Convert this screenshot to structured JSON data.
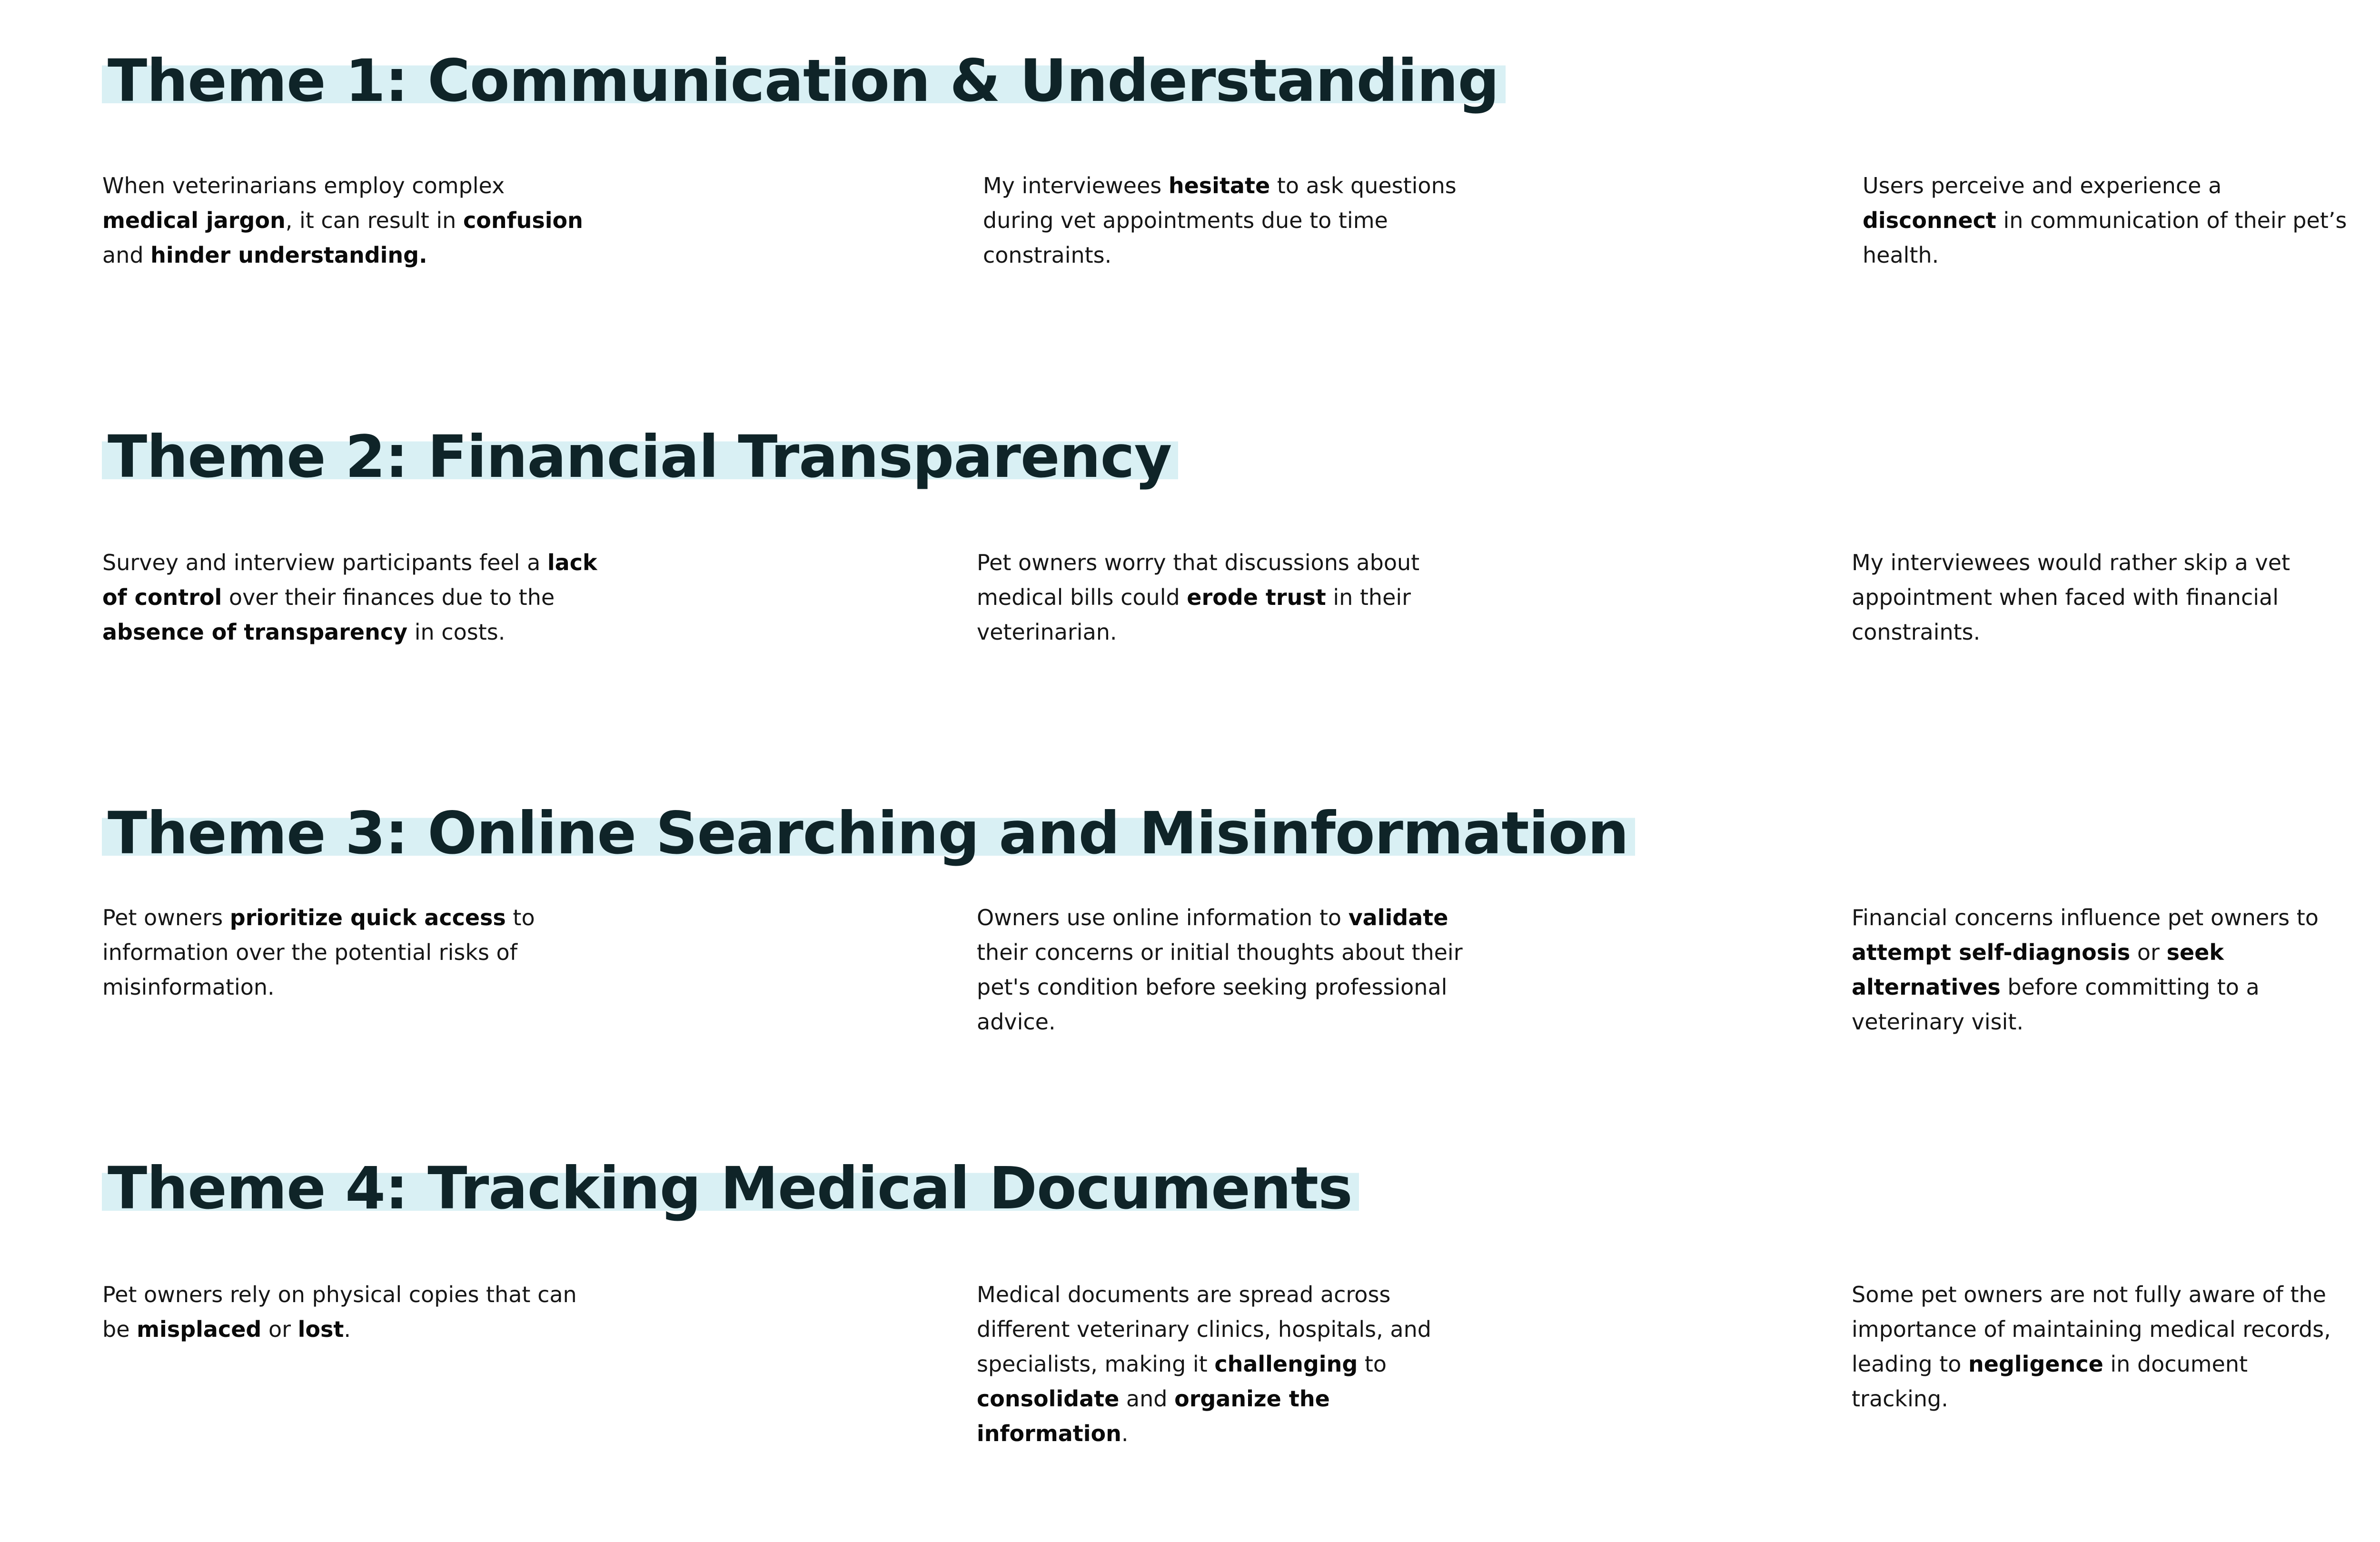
{
  "themes": [
    {
      "title": "Theme 1: Communication & Understanding",
      "insights": [
        [
          {
            "t": "When veterinarians employ complex "
          },
          {
            "t": "medical jargon",
            "b": true
          },
          {
            "t": ", it can result in "
          },
          {
            "t": "confusion",
            "b": true
          },
          {
            "t": " and "
          },
          {
            "t": "hinder understanding.",
            "b": true
          }
        ],
        [
          {
            "t": "My interviewees "
          },
          {
            "t": "hesitate",
            "b": true
          },
          {
            "t": " to ask questions during vet appointments due to time constraints."
          }
        ],
        [
          {
            "t": "Users perceive and experience a "
          },
          {
            "t": "disconnect",
            "b": true
          },
          {
            "t": " in communication of their pet’s health."
          }
        ]
      ]
    },
    {
      "title": "Theme 2: Financial Transparency",
      "insights": [
        [
          {
            "t": "Survey and interview participants feel a "
          },
          {
            "t": "lack of control",
            "b": true
          },
          {
            "t": " over their finances due to the "
          },
          {
            "t": "absence of transparency",
            "b": true
          },
          {
            "t": " in costs."
          }
        ],
        [
          {
            "t": "Pet owners worry that discussions about medical bills could "
          },
          {
            "t": "erode trust",
            "b": true
          },
          {
            "t": " in their veterinarian."
          }
        ],
        [
          {
            "t": "My interviewees would rather skip a vet appointment when faced with financial constraints."
          }
        ]
      ]
    },
    {
      "title": "Theme 3: Online Searching and Misinformation",
      "insights": [
        [
          {
            "t": "Pet owners "
          },
          {
            "t": "prioritize quick access",
            "b": true
          },
          {
            "t": " to information over the potential risks of misinformation."
          }
        ],
        [
          {
            "t": "Owners use online information to "
          },
          {
            "t": "validate",
            "b": true
          },
          {
            "t": " their concerns or initial thoughts about their pet's condition before seeking professional advice."
          }
        ],
        [
          {
            "t": "Financial concerns influence pet owners to "
          },
          {
            "t": "attempt self-diagnosis",
            "b": true
          },
          {
            "t": " or "
          },
          {
            "t": "seek alternatives",
            "b": true
          },
          {
            "t": " before committing to a veterinary visit."
          }
        ]
      ]
    },
    {
      "title": "Theme 4: Tracking Medical Documents",
      "insights": [
        [
          {
            "t": "Pet owners rely on physical copies that can be "
          },
          {
            "t": "misplaced",
            "b": true
          },
          {
            "t": " or "
          },
          {
            "t": "lost",
            "b": true
          },
          {
            "t": "."
          }
        ],
        [
          {
            "t": "Medical documents are spread across different veterinary clinics, hospitals, and specialists, making it "
          },
          {
            "t": "challenging",
            "b": true
          },
          {
            "t": " to "
          },
          {
            "t": "consolidate",
            "b": true
          },
          {
            "t": " and "
          },
          {
            "t": "organize the information",
            "b": true
          },
          {
            "t": "."
          }
        ],
        [
          {
            "t": "Some pet owners are not fully aware of the importance of maintaining medical records, leading to "
          },
          {
            "t": "negligence",
            "b": true
          },
          {
            "t": " in document tracking."
          }
        ]
      ]
    }
  ]
}
